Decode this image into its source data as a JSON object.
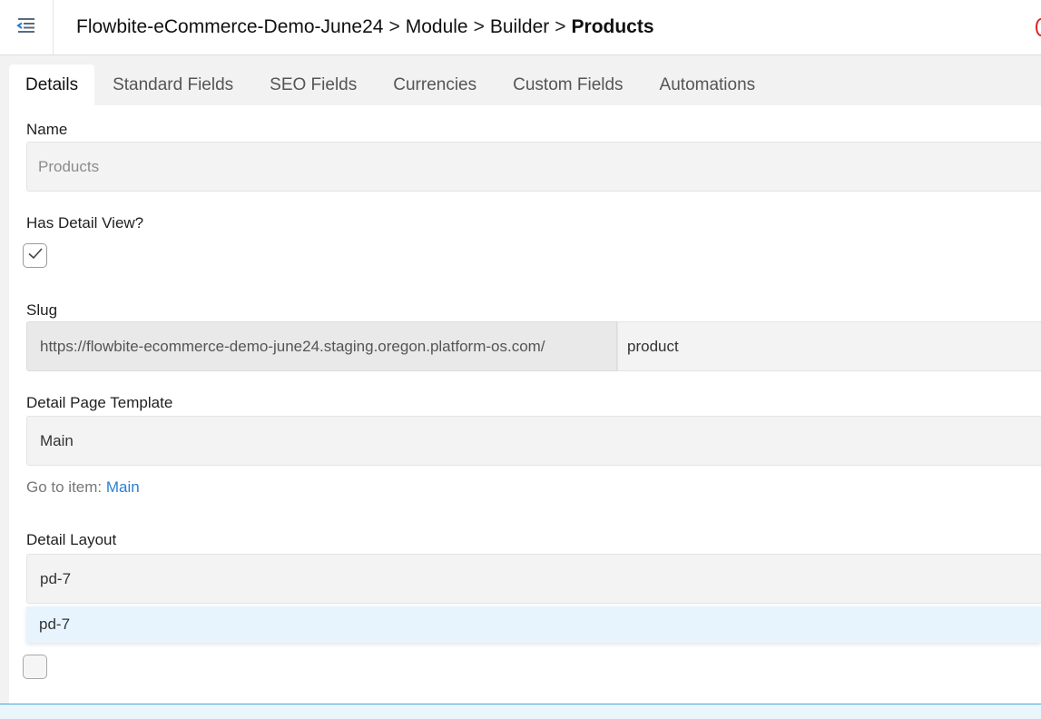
{
  "header": {
    "menu_icon": "collapse-menu-icon",
    "breadcrumb": [
      {
        "label": "Flowbite-eCommerce-Demo-June24"
      },
      {
        "label": "Module"
      },
      {
        "label": "Builder"
      },
      {
        "label": "Products"
      }
    ],
    "separator": ">"
  },
  "tabs": [
    {
      "label": "Details",
      "active": true
    },
    {
      "label": "Standard Fields",
      "active": false
    },
    {
      "label": "SEO Fields",
      "active": false
    },
    {
      "label": "Currencies",
      "active": false
    },
    {
      "label": "Custom Fields",
      "active": false
    },
    {
      "label": "Automations",
      "active": false
    }
  ],
  "form": {
    "name": {
      "label": "Name",
      "placeholder": "Products"
    },
    "has_detail_view": {
      "label": "Has Detail View?",
      "checked": true
    },
    "slug": {
      "label": "Slug",
      "prefix": "https://flowbite-ecommerce-demo-june24.staging.oregon.platform-os.com/",
      "value": "product"
    },
    "detail_page_template": {
      "label": "Detail Page Template",
      "value": "Main",
      "goto_label": "Go to item:",
      "goto_link": "Main"
    },
    "detail_layout": {
      "label": "Detail Layout",
      "value": "pd-7",
      "options": [
        "pd-7"
      ]
    },
    "extra_checkbox": {
      "checked": false
    }
  },
  "colors": {
    "link": "#2b7fd4",
    "tab_bar_bg": "#f2f2f2",
    "dropdown_highlight": "#e8f4fd",
    "bottom_bar_border": "#4aa3d8"
  }
}
